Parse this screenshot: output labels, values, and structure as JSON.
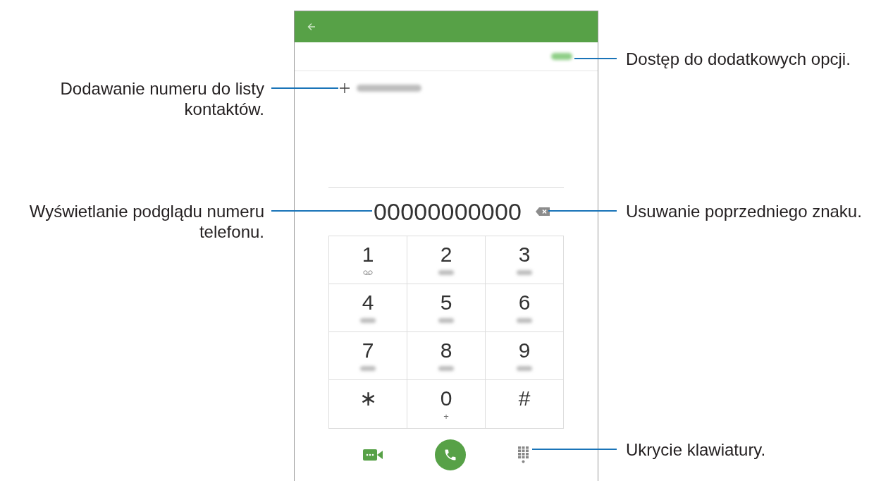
{
  "dialer": {
    "number": "00000000000",
    "keys": [
      {
        "digit": "1",
        "kind": "voicemail"
      },
      {
        "digit": "2",
        "kind": "blurred"
      },
      {
        "digit": "3",
        "kind": "blurred"
      },
      {
        "digit": "4",
        "kind": "blurred"
      },
      {
        "digit": "5",
        "kind": "blurred"
      },
      {
        "digit": "6",
        "kind": "blurred"
      },
      {
        "digit": "7",
        "kind": "blurred"
      },
      {
        "digit": "8",
        "kind": "blurred"
      },
      {
        "digit": "9",
        "kind": "blurred"
      },
      {
        "digit": "∗",
        "kind": "plain"
      },
      {
        "digit": "0",
        "kind": "text",
        "sub": "+"
      },
      {
        "digit": "#",
        "kind": "plain"
      }
    ]
  },
  "callouts": [
    {
      "kind": "right",
      "text": "Dostęp do dodatkowych opcji."
    },
    {
      "kind": "left",
      "text": "Dodawanie numeru do listy kontaktów."
    },
    {
      "kind": "left",
      "text": "Wyświetlanie podglądu numeru telefonu."
    },
    {
      "kind": "right",
      "text": "Usuwanie poprzedniego znaku."
    },
    {
      "kind": "right",
      "text": "Ukrycie klawiatury."
    }
  ]
}
